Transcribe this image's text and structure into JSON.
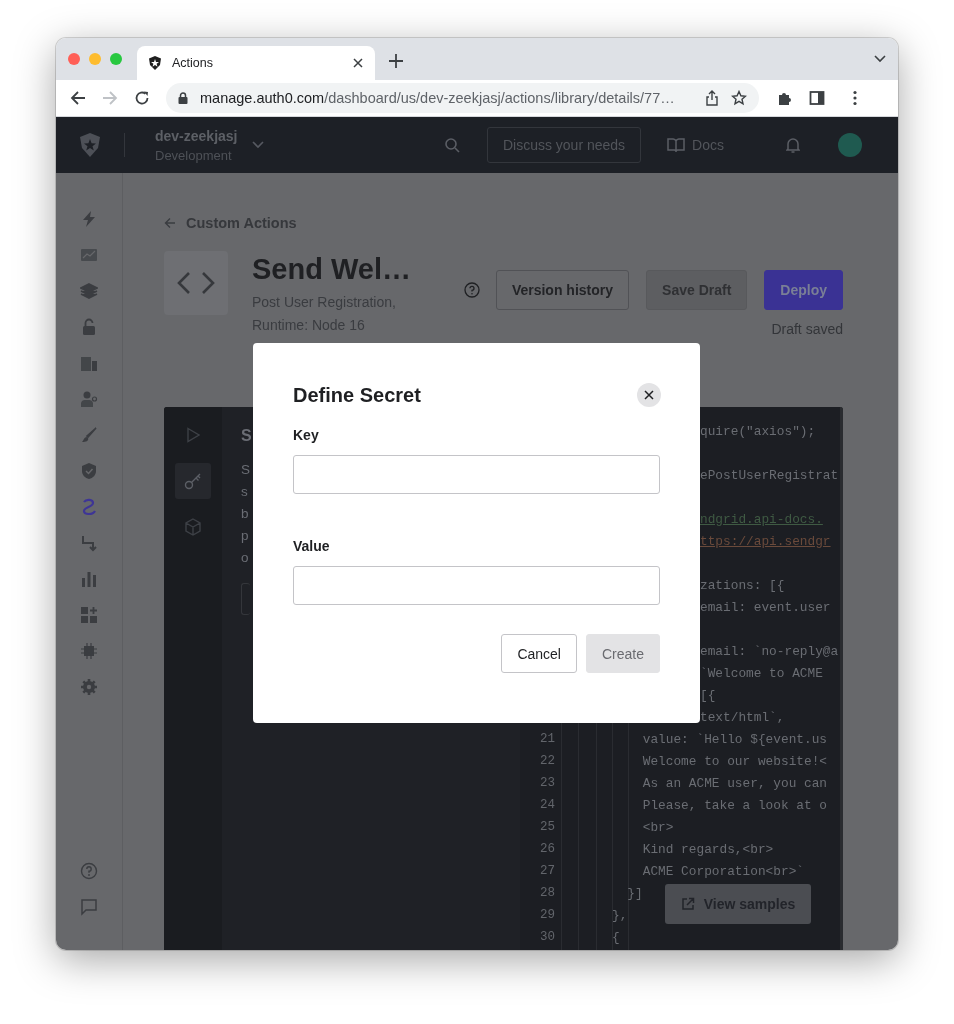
{
  "browser": {
    "tab": {
      "title": "Actions"
    },
    "nav": {
      "back_disabled": false,
      "forward_disabled": true
    },
    "address": {
      "host": "manage.auth0.com",
      "path": "/dashboard/us/dev-zeekjasj/actions/library/details/77…"
    }
  },
  "header": {
    "tenant": "dev-zeekjasj",
    "environment": "Development",
    "discuss_button": "Discuss your needs",
    "docs_link": "Docs"
  },
  "sidebar": {
    "items": [
      {
        "kind": "bolt",
        "selected": false
      },
      {
        "kind": "chart",
        "selected": false
      },
      {
        "kind": "stack",
        "selected": false
      },
      {
        "kind": "lock",
        "selected": false
      },
      {
        "kind": "building",
        "selected": false
      },
      {
        "kind": "users",
        "selected": false
      },
      {
        "kind": "brush",
        "selected": false
      },
      {
        "kind": "shield",
        "selected": false
      },
      {
        "kind": "actions",
        "selected": true
      },
      {
        "kind": "flow",
        "selected": false
      },
      {
        "kind": "stats",
        "selected": false
      },
      {
        "kind": "extensions",
        "selected": false
      },
      {
        "kind": "chip",
        "selected": false
      },
      {
        "kind": "settings",
        "selected": false
      }
    ],
    "bottom": [
      {
        "kind": "help"
      },
      {
        "kind": "chat"
      }
    ]
  },
  "page": {
    "back_link": "Custom Actions",
    "title": "Send Wel…",
    "subtitle": "Post User Registration, Runtime: Node 16",
    "buttons": [
      {
        "label": "Version history",
        "kind": "outline",
        "disabled": false
      },
      {
        "label": "Save Draft",
        "kind": "secondary",
        "disabled": true
      },
      {
        "label": "Deploy",
        "kind": "primary",
        "disabled": false
      }
    ],
    "status": "Draft saved"
  },
  "editor": {
    "rail": [
      {
        "kind": "run",
        "selected": false
      },
      {
        "kind": "secrets",
        "selected": true
      },
      {
        "kind": "packages",
        "selected": false
      }
    ],
    "panel": {
      "title": "S",
      "lines": [
        "S",
        "s",
        "b",
        "p",
        "o"
      ]
    },
    "code": [
      {
        "kind": "cut",
        "text": "quire(\"axios\");"
      },
      {
        "kind": "blank"
      },
      {
        "kind": "cut",
        "text": "ePostUserRegistrat"
      },
      {
        "kind": "blank"
      },
      {
        "kind": "cut",
        "text": "ndgrid.api-docs.",
        "color": "#3f5a43"
      },
      {
        "kind": "cut",
        "text": "ttps://api.sendgr",
        "color": "#6a4a3b"
      },
      {
        "kind": "blank"
      },
      {
        "kind": "cut",
        "text": "zations: [{"
      },
      {
        "kind": "cut",
        "text": "email: event.user"
      },
      {
        "kind": "blank"
      },
      {
        "kind": "cut",
        "text": "email: `no-reply@a"
      },
      {
        "kind": "cut",
        "text": "`Welcome to ACME"
      },
      {
        "kind": "cut",
        "text": "[{"
      },
      {
        "kind": "cut",
        "text": "text/html`,"
      },
      {
        "kind": "full",
        "number": "21",
        "text": "    value: `Hello ${event.us"
      },
      {
        "kind": "full",
        "number": "22",
        "text": "    Welcome to our website!<"
      },
      {
        "kind": "full",
        "number": "23",
        "text": "    As an ACME user, you can"
      },
      {
        "kind": "full",
        "number": "24",
        "text": "    Please, take a look at o"
      },
      {
        "kind": "full",
        "number": "25",
        "text": "    <br>"
      },
      {
        "kind": "full",
        "number": "26",
        "text": "    Kind regards,<br>"
      },
      {
        "kind": "full",
        "number": "27",
        "text": "    ACME Corporation<br>`"
      },
      {
        "kind": "full",
        "number": "28",
        "text": "  }]"
      },
      {
        "kind": "full",
        "number": "29",
        "text": "},"
      },
      {
        "kind": "full",
        "number": "30",
        "text": "{"
      }
    ],
    "samples_button": "View samples"
  },
  "modal": {
    "title": "Define Secret",
    "fields": [
      {
        "label": "Key"
      },
      {
        "label": "Value"
      }
    ],
    "buttons": [
      {
        "label": "Cancel",
        "disabled": false
      },
      {
        "label": "Create",
        "disabled": true
      }
    ]
  }
}
